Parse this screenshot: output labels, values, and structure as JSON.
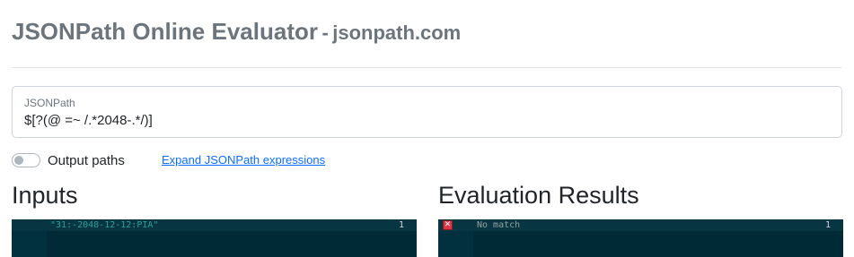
{
  "header": {
    "title": "JSONPath Online Evaluator",
    "separator": "-",
    "site": "jsonpath.com"
  },
  "jsonpath": {
    "label": "JSONPath",
    "value": "$[?(@ =~ /.*2048-.*/)]"
  },
  "options": {
    "output_paths_label": "Output paths",
    "output_paths_enabled": false,
    "expand_link": "Expand JSONPath expressions"
  },
  "inputs": {
    "title": "Inputs",
    "lines": [
      {
        "number": "1",
        "text": "\"31:-2048-12-12:PIA\""
      }
    ]
  },
  "results": {
    "title": "Evaluation Results",
    "lines": [
      {
        "number": "1",
        "text": "No match",
        "error_icon": "error-x-icon"
      }
    ]
  },
  "colors": {
    "editor_bg": "#002b36",
    "string": "#2aa198",
    "link": "#0d6efd",
    "error": "#dc3545"
  }
}
